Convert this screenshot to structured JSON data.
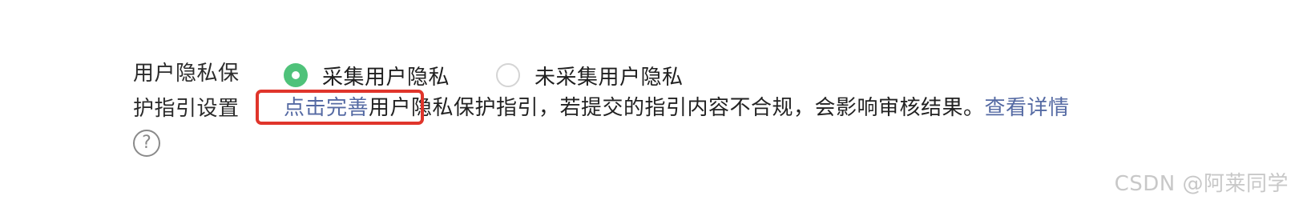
{
  "setting": {
    "label_line1": "用户隐私保",
    "label_line2": "护指引设置",
    "help_icon_symbol": "?",
    "options": [
      {
        "label": "采集用户隐私",
        "checked": true
      },
      {
        "label": "未采集用户隐私",
        "checked": false
      }
    ],
    "guide": {
      "link_complete": "点击完善",
      "text": "用户隐私保护指引，若提交的指引内容不合规，会影响审核结果。",
      "link_details": "查看详情"
    }
  },
  "colors": {
    "radio_checked": "#4fc27a",
    "link": "#556aa3",
    "highlight_border": "#e0352b"
  },
  "icons": {
    "help": "question-circle-icon",
    "radio_checked": "radio-checked-icon",
    "radio_unchecked": "radio-unchecked-icon"
  },
  "watermark": "CSDN @阿莱同学"
}
